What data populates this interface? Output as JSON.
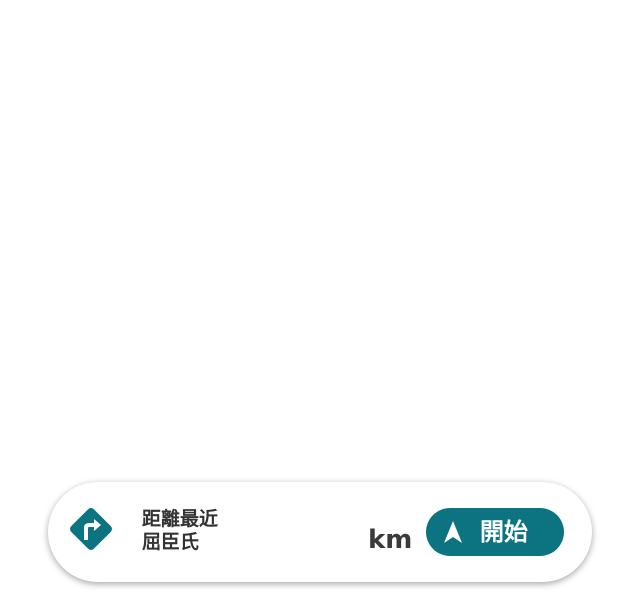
{
  "nav_card": {
    "sign_icon": "turn-right-sign-icon",
    "destination_line1": "距離最近",
    "destination_line2": "屈臣氏",
    "distance_unit": "km",
    "start_button": {
      "icon": "navigation-arrow-icon",
      "label": "開始"
    }
  },
  "colors": {
    "accent": "#0c7480",
    "card_background": "#ffffff",
    "text": "#333333"
  }
}
